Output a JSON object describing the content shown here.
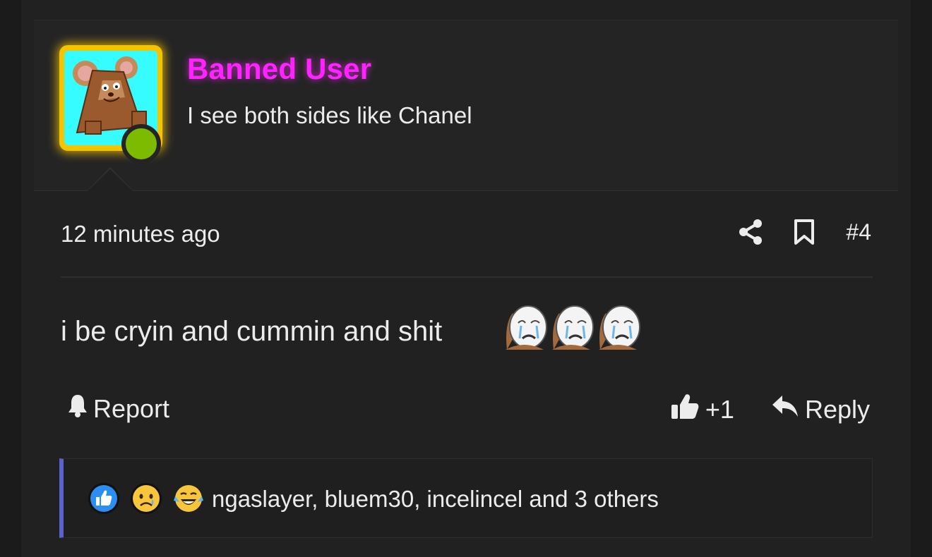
{
  "user": {
    "username": "Banned User",
    "user_title": "I see both sides like Chanel",
    "online": true
  },
  "post": {
    "timestamp": "12 minutes ago",
    "post_number": "#4",
    "message": "i be cryin and cummin and shit",
    "emotes": [
      "crying-wojak-emote",
      "crying-wojak-emote",
      "crying-wojak-emote"
    ]
  },
  "actions": {
    "report_label": "Report",
    "like_count": "+1",
    "reply_label": "Reply"
  },
  "reactions": {
    "icons": [
      "like-reaction-icon",
      "sad-reaction-icon",
      "laugh-cry-reaction-icon"
    ],
    "summary": "ngaslayer, bluem30, incelincel and 3 others"
  },
  "colors": {
    "username": "#ff24ff",
    "avatar_border": "#f5c400",
    "online_dot": "#7dbb00",
    "reaction_accent": "#5a64c8"
  }
}
